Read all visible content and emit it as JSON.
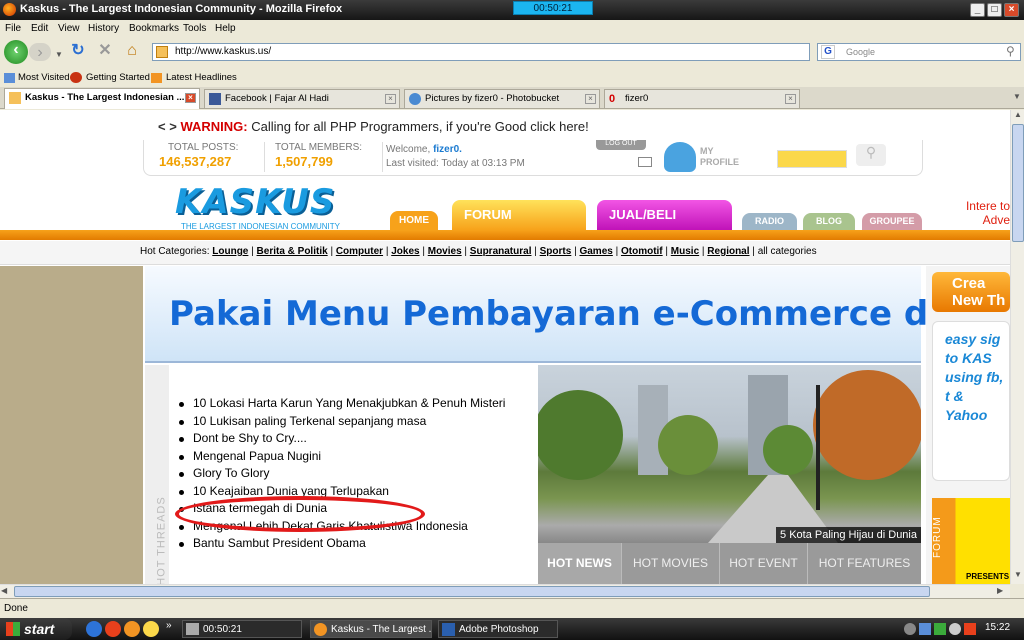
{
  "window": {
    "title": "Kaskus - The Largest Indonesian Community - Mozilla Firefox",
    "timer": "00:50:21"
  },
  "menu": [
    "File",
    "Edit",
    "View",
    "History",
    "Bookmarks",
    "Tools",
    "Help"
  ],
  "nav": {
    "url": "http://www.kaskus.us/",
    "search_placeholder": "Google"
  },
  "bookmarks": [
    "Most Visited",
    "Getting Started",
    "Latest Headlines"
  ],
  "tabs": [
    {
      "label": "Kaskus - The Largest Indonesian ...",
      "active": true
    },
    {
      "label": "Facebook | Fajar Al Hadi"
    },
    {
      "label": "Pictures by fizer0 - Photobucket"
    },
    {
      "label": "fizer0"
    }
  ],
  "page": {
    "warning_label": "WARNING:",
    "warning_text": "Calling for all PHP Programmers, if you're Good click here!",
    "stats": {
      "posts_label": "TOTAL POSTS:",
      "posts": "146,537,287",
      "members_label": "TOTAL MEMBERS:",
      "members": "1,507,799",
      "welcome": "Welcome,",
      "user": "fizer0.",
      "visited": "Last visited: Today at 03:13 PM",
      "logout": "LOG OUT",
      "profile": "MY PROFILE"
    },
    "logo": "KASKUS",
    "logo_sub": "THE LARGEST INDONESIAN COMMUNITY",
    "navtabs": {
      "home": "HOME",
      "forum": "FORUM",
      "jual": "JUAL/BELI",
      "radio": "RADIO",
      "blog": "BLOG",
      "groupee": "GROUPEE"
    },
    "ad_right": "Intere to Adve",
    "hotcat_label": "Hot Categories:",
    "hotcats": [
      "Lounge",
      "Berita & Politik",
      "Computer",
      "Jokes",
      "Movies",
      "Supranatural",
      "Sports",
      "Games",
      "Otomotif",
      "Music",
      "Regional"
    ],
    "allcats": "all categories",
    "banner": "Pakai Menu Pembayaran e-Commerce di",
    "hot_threads_label": "HOT THREADS",
    "threads": [
      "10 Lokasi Harta Karun Yang Menakjubkan & Penuh Misteri",
      "10 Lukisan paling Terkenal sepanjang masa",
      "Dont be Shy to Cry....",
      "Mengenal Papua Nugini",
      "Glory To Glory",
      "10 Keajaiban Dunia yang Terlupakan",
      "Istana termegah di Dunia",
      "Mengenal Lebih Dekat Garis Khatulistiwa Indonesia",
      "Bantu Sambut President Obama"
    ],
    "photo_caption": "5 Kota Paling Hijau di Dunia",
    "hot_tabs": [
      "HOT NEWS",
      "HOT MOVIES",
      "HOT EVENT",
      "HOT FEATURES"
    ],
    "right": {
      "create": "Crea New Th",
      "easy": "easy sig to KAS using fb, t & Yahoo",
      "forum_vert": "FORUM",
      "presents": "PRESENTS"
    }
  },
  "status": "Done",
  "taskbar": {
    "start": "start",
    "items": [
      "00:50:21",
      "Kaskus - The Largest ...",
      "Adobe Photoshop"
    ],
    "clock": "15:22"
  }
}
